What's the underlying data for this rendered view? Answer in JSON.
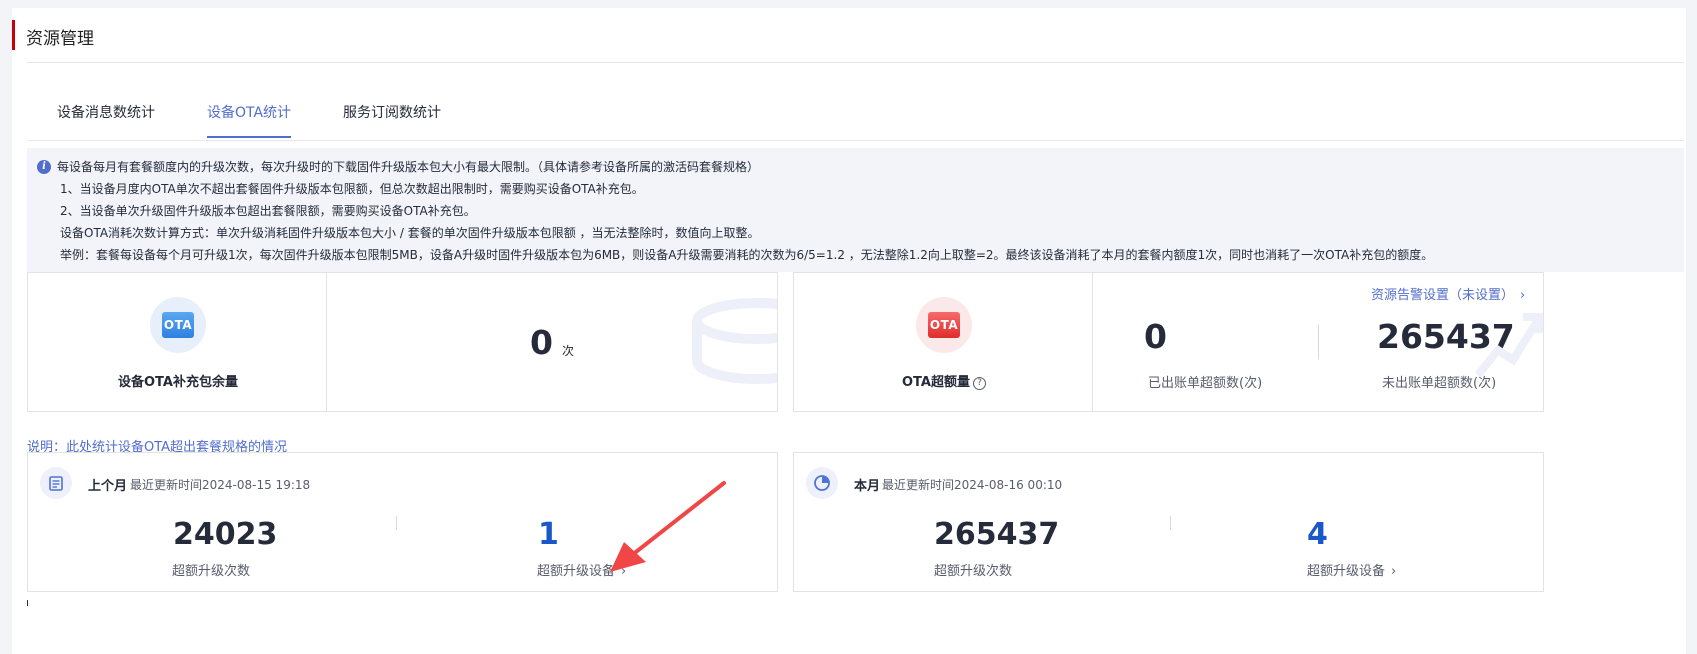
{
  "page": {
    "title": "资源管理"
  },
  "tabs": [
    {
      "label": "设备消息数统计",
      "active": false
    },
    {
      "label": "设备OTA统计",
      "active": true
    },
    {
      "label": "服务订阅数统计",
      "active": false
    }
  ],
  "notice": {
    "icon": "info-icon",
    "lines": [
      "每设备每月有套餐额度内的升级次数，每次升级时的下载固件升级版本包大小有最大限制。（具体请参考设备所属的激活码套餐规格）",
      "1、当设备月度内OTA单次不超出套餐固件升级版本包限额，但总次数超出限制时，需要购买设备OTA补充包。",
      "2、当设备单次升级固件升级版本包超出套餐限额，需要购买设备OTA补充包。",
      "设备OTA消耗次数计算方式：单次升级消耗固件升级版本包大小 / 套餐的单次固件升级版本包限额 ，当无法整除时，数值向上取整。",
      "举例：套餐每设备每个月可升级1次，每次固件升级版本包限制5MB，设备A升级时固件升级版本包为6MB，则设备A升级需要消耗的次数为6/5=1.2 ，无法整除1.2向上取整=2。最终该设备消耗了本月的套餐内额度1次，同时也消耗了一次OTA补充包的额度。"
    ]
  },
  "supplement_card": {
    "icon_text": "OTA",
    "label": "设备OTA补充包余量",
    "value": "0",
    "unit": "次"
  },
  "overage_card": {
    "icon_text": "OTA",
    "label": "OTA超额量",
    "alarm_link": "资源告警设置（未设置）",
    "billed_value": "0",
    "billed_label": "已出账单超额数(次)",
    "unbilled_value": "265437",
    "unbilled_label": "未出账单超额数(次)"
  },
  "explain_text": "说明：此处统计设备OTA超出套餐规格的情况",
  "last_month": {
    "title": "上个月",
    "updated": "最近更新时间2024-08-15 19:18",
    "count_value": "24023",
    "count_label": "超额升级次数",
    "devices_value": "1",
    "devices_label": "超额升级设备"
  },
  "this_month": {
    "title": "本月",
    "updated": "最近更新时间2024-08-16 00:10",
    "count_value": "265437",
    "count_label": "超额升级次数",
    "devices_value": "4",
    "devices_label": "超额升级设备"
  },
  "colors": {
    "accent_red": "#c7000b",
    "link_blue": "#526ecc",
    "number_blue": "#1a57c8",
    "annotation_arrow": "#f04646"
  }
}
